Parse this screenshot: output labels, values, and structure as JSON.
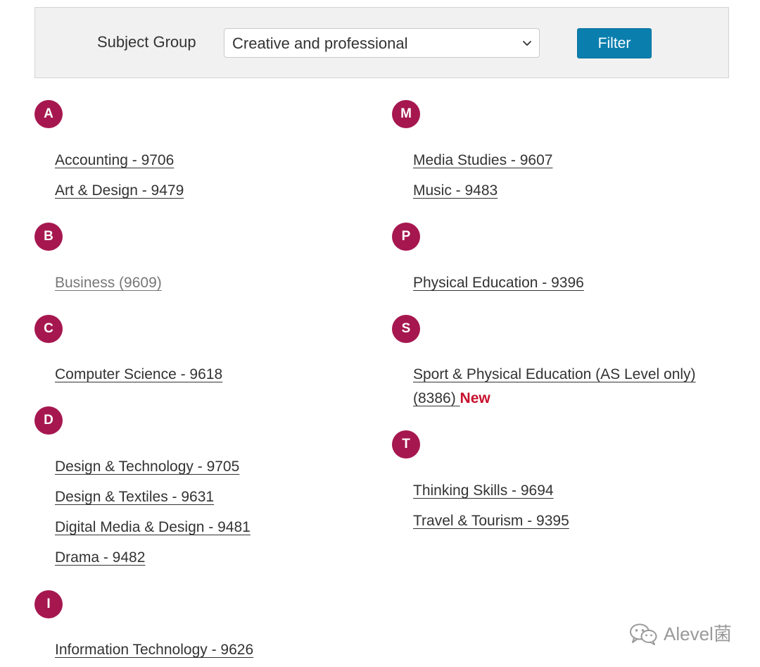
{
  "filter": {
    "label": "Subject Group",
    "selected": "Creative and professional",
    "button": "Filter"
  },
  "sections": {
    "a": {
      "letter": "A",
      "items": [
        "Accounting - 9706",
        "Art & Design - 9479"
      ]
    },
    "b": {
      "letter": "B",
      "items": [
        "Business (9609)"
      ]
    },
    "c": {
      "letter": "C",
      "items": [
        "Computer Science - 9618"
      ]
    },
    "d": {
      "letter": "D",
      "items": [
        "Design & Technology - 9705",
        "Design & Textiles - 9631",
        "Digital Media & Design - 9481",
        "Drama - 9482"
      ]
    },
    "i": {
      "letter": "I",
      "items": [
        "Information Technology - 9626"
      ]
    },
    "m": {
      "letter": "M",
      "items": [
        "Media Studies - 9607",
        "Music - 9483"
      ]
    },
    "p": {
      "letter": "P",
      "items": [
        "Physical Education - 9396"
      ]
    },
    "s": {
      "letter": "S",
      "items": [
        "Sport & Physical Education (AS Level only) (8386)"
      ],
      "new_tag": "New"
    },
    "t": {
      "letter": "T",
      "items": [
        "Thinking Skills - 9694",
        "Travel & Tourism - 9395"
      ]
    }
  },
  "watermark": {
    "text": "Alevel菌",
    "icon": "wechat-icon"
  },
  "colors": {
    "badge": "#a6174f",
    "button": "#0a7fae",
    "new_tag": "#c8102e",
    "link": "#333333",
    "visited_link": "#777777"
  }
}
